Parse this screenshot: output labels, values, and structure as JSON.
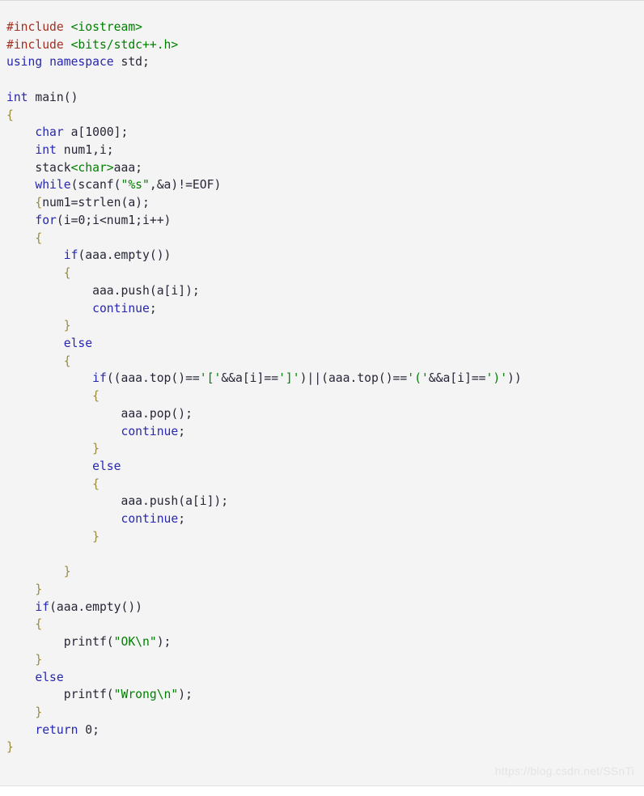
{
  "code_block": {
    "language": "cpp",
    "background_color": "#f4f4f4",
    "colors": {
      "preprocessor": "#a3301f",
      "string": "#008000",
      "keyword": "#2727b0",
      "brace": "#9a8c3e",
      "plain": "#262637",
      "number": "#262637",
      "watermark": "#e4e4e4"
    },
    "watermark": "https://blog.csdn.net/SSnTi",
    "lines": [
      [
        [
          "t-pre",
          "#include "
        ],
        [
          "t-str",
          "<iostream>"
        ]
      ],
      [
        [
          "t-pre",
          "#include "
        ],
        [
          "t-str",
          "<bits/stdc++.h>"
        ]
      ],
      [
        [
          "t-kw",
          "using"
        ],
        [
          "t-pln",
          " "
        ],
        [
          "t-kw",
          "namespace"
        ],
        [
          "t-pln",
          " std;"
        ]
      ],
      [],
      [
        [
          "t-kw",
          "int"
        ],
        [
          "t-pln",
          " main()"
        ]
      ],
      [
        [
          "t-brace",
          "{"
        ]
      ],
      [
        [
          "t-pln",
          "    "
        ],
        [
          "t-kw",
          "char"
        ],
        [
          "t-pln",
          " a["
        ],
        [
          "t-num",
          "1000"
        ],
        [
          "t-pln",
          "];"
        ]
      ],
      [
        [
          "t-pln",
          "    "
        ],
        [
          "t-kw",
          "int"
        ],
        [
          "t-pln",
          " num1,i;"
        ]
      ],
      [
        [
          "t-pln",
          "    stack"
        ],
        [
          "t-str",
          "<char>"
        ],
        [
          "t-pln",
          "aaa;"
        ]
      ],
      [
        [
          "t-pln",
          "    "
        ],
        [
          "t-kw",
          "while"
        ],
        [
          "t-pln",
          "(scanf("
        ],
        [
          "t-str",
          "\"%s\""
        ],
        [
          "t-pln",
          ",&a)!=EOF)"
        ]
      ],
      [
        [
          "t-pln",
          "    "
        ],
        [
          "t-brace",
          "{"
        ],
        [
          "t-pln",
          "num1=strlen(a);"
        ]
      ],
      [
        [
          "t-pln",
          "    "
        ],
        [
          "t-kw",
          "for"
        ],
        [
          "t-pln",
          "(i="
        ],
        [
          "t-num",
          "0"
        ],
        [
          "t-pln",
          ";i<num1;i++)"
        ]
      ],
      [
        [
          "t-pln",
          "    "
        ],
        [
          "t-brace",
          "{"
        ]
      ],
      [
        [
          "t-pln",
          "        "
        ],
        [
          "t-kw",
          "if"
        ],
        [
          "t-pln",
          "(aaa.empty())"
        ]
      ],
      [
        [
          "t-pln",
          "        "
        ],
        [
          "t-brace",
          "{"
        ]
      ],
      [
        [
          "t-pln",
          "            aaa.push(a[i]);"
        ]
      ],
      [
        [
          "t-pln",
          "            "
        ],
        [
          "t-kw",
          "continue"
        ],
        [
          "t-pln",
          ";"
        ]
      ],
      [
        [
          "t-pln",
          "        "
        ],
        [
          "t-brace",
          "}"
        ]
      ],
      [
        [
          "t-pln",
          "        "
        ],
        [
          "t-kw",
          "else"
        ]
      ],
      [
        [
          "t-pln",
          "        "
        ],
        [
          "t-brace",
          "{"
        ]
      ],
      [
        [
          "t-pln",
          "            "
        ],
        [
          "t-kw",
          "if"
        ],
        [
          "t-pln",
          "((aaa.top()=="
        ],
        [
          "t-str",
          "'['"
        ],
        [
          "t-pln",
          "&&a[i]=="
        ],
        [
          "t-str",
          "']'"
        ],
        [
          "t-pln",
          ")||(aaa.top()=="
        ],
        [
          "t-str",
          "'('"
        ],
        [
          "t-pln",
          "&&a[i]=="
        ],
        [
          "t-str",
          "')'"
        ],
        [
          "t-pln",
          "))"
        ]
      ],
      [
        [
          "t-pln",
          "            "
        ],
        [
          "t-brace",
          "{"
        ]
      ],
      [
        [
          "t-pln",
          "                aaa.pop();"
        ]
      ],
      [
        [
          "t-pln",
          "                "
        ],
        [
          "t-kw",
          "continue"
        ],
        [
          "t-pln",
          ";"
        ]
      ],
      [
        [
          "t-pln",
          "            "
        ],
        [
          "t-brace",
          "}"
        ]
      ],
      [
        [
          "t-pln",
          "            "
        ],
        [
          "t-kw",
          "else"
        ]
      ],
      [
        [
          "t-pln",
          "            "
        ],
        [
          "t-brace",
          "{"
        ]
      ],
      [
        [
          "t-pln",
          "                aaa.push(a[i]);"
        ]
      ],
      [
        [
          "t-pln",
          "                "
        ],
        [
          "t-kw",
          "continue"
        ],
        [
          "t-pln",
          ";"
        ]
      ],
      [
        [
          "t-pln",
          "            "
        ],
        [
          "t-brace",
          "}"
        ]
      ],
      [],
      [
        [
          "t-pln",
          "        "
        ],
        [
          "t-brace",
          "}"
        ]
      ],
      [
        [
          "t-pln",
          "    "
        ],
        [
          "t-brace",
          "}"
        ]
      ],
      [
        [
          "t-pln",
          "    "
        ],
        [
          "t-kw",
          "if"
        ],
        [
          "t-pln",
          "(aaa.empty())"
        ]
      ],
      [
        [
          "t-pln",
          "    "
        ],
        [
          "t-brace",
          "{"
        ]
      ],
      [
        [
          "t-pln",
          "        printf("
        ],
        [
          "t-str",
          "\"OK\\n\""
        ],
        [
          "t-pln",
          ");"
        ]
      ],
      [
        [
          "t-pln",
          "    "
        ],
        [
          "t-brace",
          "}"
        ]
      ],
      [
        [
          "t-pln",
          "    "
        ],
        [
          "t-kw",
          "else"
        ]
      ],
      [
        [
          "t-pln",
          "        printf("
        ],
        [
          "t-str",
          "\"Wrong\\n\""
        ],
        [
          "t-pln",
          ");"
        ]
      ],
      [
        [
          "t-pln",
          "    "
        ],
        [
          "t-brace",
          "}"
        ]
      ],
      [
        [
          "t-pln",
          "    "
        ],
        [
          "t-kw",
          "return"
        ],
        [
          "t-pln",
          " "
        ],
        [
          "t-num",
          "0"
        ],
        [
          "t-pln",
          ";"
        ]
      ],
      [
        [
          "t-brace",
          "}"
        ]
      ]
    ]
  }
}
